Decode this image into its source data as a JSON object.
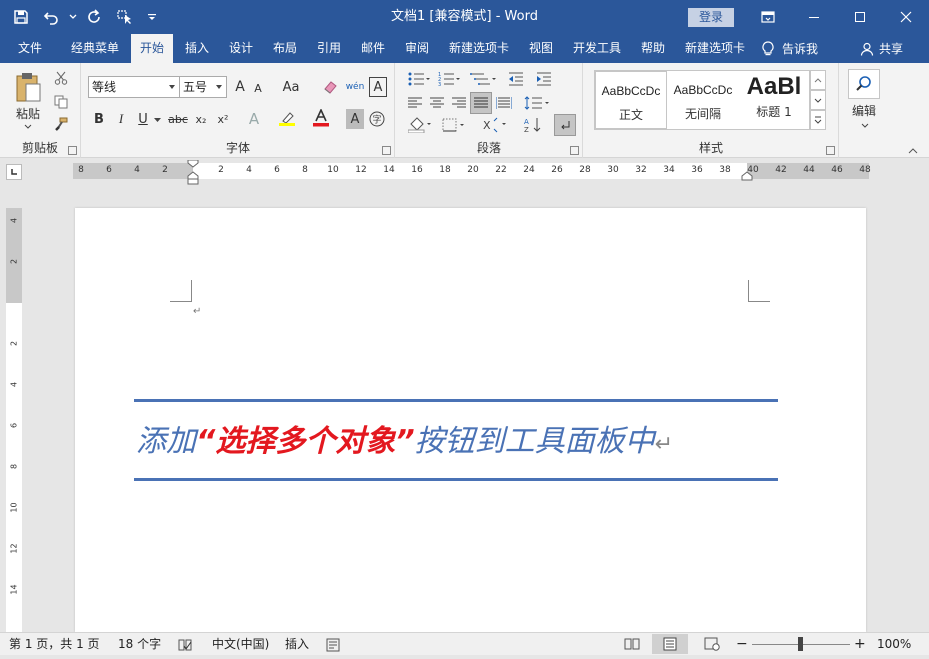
{
  "titlebar": {
    "title": "文档1 [兼容模式] - Word",
    "login": "登录"
  },
  "tabs": [
    "文件",
    "经典菜单",
    "开始",
    "插入",
    "设计",
    "布局",
    "引用",
    "邮件",
    "审阅",
    "新建选项卡",
    "视图",
    "开发工具",
    "帮助",
    "新建选项卡"
  ],
  "active_tab": "开始",
  "tellme": "告诉我",
  "share": "共享",
  "ribbon": {
    "clipboard": {
      "label": "剪贴板",
      "paste": "粘贴"
    },
    "font": {
      "label": "字体",
      "font_name": "等线",
      "font_size": "五号",
      "grow": "A",
      "shrink": "A",
      "change_case": "Aa",
      "phonetic": "wén",
      "bold": "B",
      "italic": "I",
      "underline": "U",
      "strike": "abc",
      "sub": "x₂",
      "sup": "x²"
    },
    "paragraph": {
      "label": "段落"
    },
    "styles": {
      "label": "样式",
      "items": [
        {
          "sample": "AaBbCcDc",
          "name": "正文"
        },
        {
          "sample": "AaBbCcDc",
          "name": "无间隔"
        },
        {
          "sample": "AaBl",
          "name": "标题 1"
        }
      ]
    },
    "editing": {
      "label": "编辑"
    }
  },
  "hruler_numbers": [
    "8",
    "6",
    "4",
    "2",
    "",
    "2",
    "4",
    "6",
    "8",
    "10",
    "12",
    "14",
    "16",
    "18",
    "20",
    "22",
    "24",
    "26",
    "28",
    "30",
    "32",
    "34",
    "36",
    "38",
    "40",
    "42",
    "44",
    "46",
    "48"
  ],
  "vruler_numbers": [
    "4",
    "2",
    "",
    "2",
    "4",
    "6",
    "8",
    "10",
    "12",
    "14"
  ],
  "document": {
    "part1": "添加",
    "part2": "“选择多个对象”",
    "part3": "按钮到工具面板中",
    "para_mark": "↵"
  },
  "statusbar": {
    "pages": "第 1 页，共 1 页",
    "words": "18 个字",
    "language": "中文(中国)",
    "mode": "插入",
    "zoom": "100%",
    "zoom_minus": "−",
    "zoom_plus": "+"
  },
  "colors": {
    "brand": "#2b579a",
    "accent_text": "#4a72b5",
    "highlight_text": "#e3181f"
  }
}
